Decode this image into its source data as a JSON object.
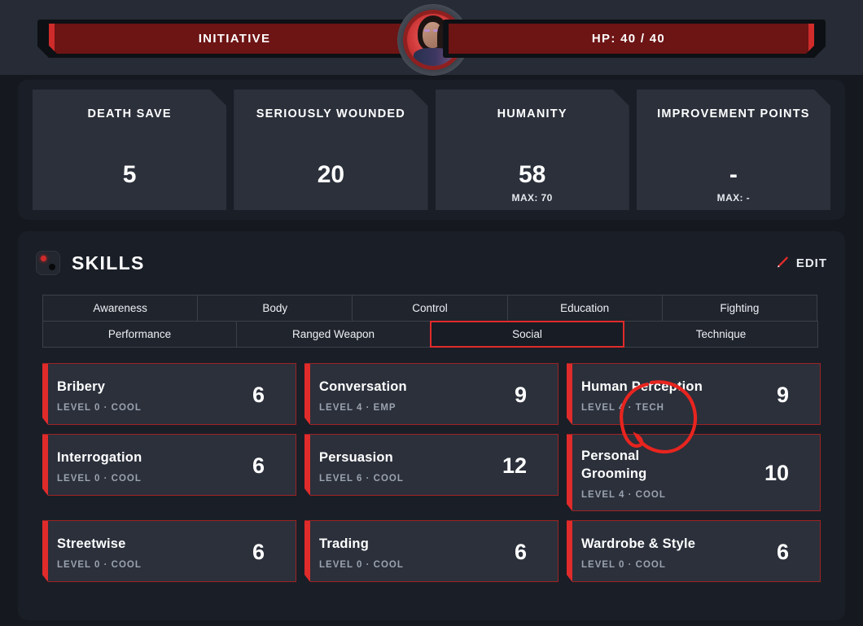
{
  "topbar": {
    "initiative_label": "INITIATIVE",
    "hp_label": "HP: 40 / 40",
    "avatar_name": "character-portrait"
  },
  "stats": [
    {
      "title": "DEATH SAVE",
      "value": "5",
      "max": ""
    },
    {
      "title": "SERIOUSLY WOUNDED",
      "value": "20",
      "max": ""
    },
    {
      "title": "HUMANITY",
      "value": "58",
      "max": "MAX: 70"
    },
    {
      "title": "IMPROVEMENT POINTS",
      "value": "-",
      "max": "MAX: -"
    }
  ],
  "skills_panel": {
    "title": "SKILLS",
    "edit_label": "EDIT",
    "dice_icon": "dice-icon",
    "pencil_icon": "pencil-icon",
    "tabs_row1": [
      "Awareness",
      "Body",
      "Control",
      "Education",
      "Fighting"
    ],
    "tabs_row2": [
      "Performance",
      "Ranged Weapon",
      "Social",
      "Technique"
    ],
    "selected_tab": "Social",
    "skills": [
      {
        "name": "Bribery",
        "value": "6",
        "meta": "LEVEL 0 ·  COOL"
      },
      {
        "name": "Conversation",
        "value": "9",
        "meta": "LEVEL 4 ·  EMP"
      },
      {
        "name": "Human Perception",
        "value": "9",
        "meta": "LEVEL 4 ·  TECH"
      },
      {
        "name": "Interrogation",
        "value": "6",
        "meta": "LEVEL 0 ·  COOL"
      },
      {
        "name": "Persuasion",
        "value": "12",
        "meta": "LEVEL 6 ·  COOL"
      },
      {
        "name": "Personal Grooming",
        "value": "10",
        "meta": "LEVEL 4 ·  COOL"
      },
      {
        "name": "Streetwise",
        "value": "6",
        "meta": "LEVEL 0 ·  COOL"
      },
      {
        "name": "Trading",
        "value": "6",
        "meta": "LEVEL 0 ·  COOL"
      },
      {
        "name": "Wardrobe & Style",
        "value": "6",
        "meta": "LEVEL 0 ·  COOL"
      }
    ]
  },
  "annotation": {
    "shape": "hand-drawn-red-circle",
    "target": "TECH"
  },
  "colors": {
    "page_bg": "#15181f",
    "panel_bg": "#1a1e27",
    "card_bg": "#2b303b",
    "topbar_bg": "#262b35",
    "accent_red": "#e02b2b",
    "deep_red": "#6d1414",
    "text": "#ffffff",
    "muted": "#9aa3af"
  }
}
